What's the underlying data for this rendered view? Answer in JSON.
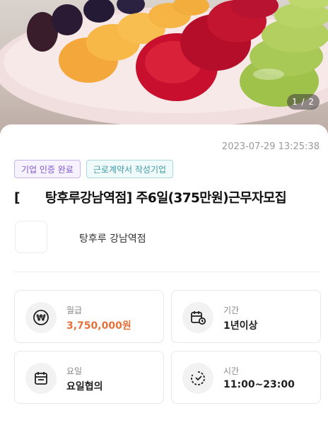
{
  "gallery": {
    "page_indicator": "1 / 2"
  },
  "post": {
    "timestamp": "2023-07-29 13:25:38",
    "badges": [
      "기업 인증 완료",
      "근로계약서 작성기업"
    ],
    "title_prefix": "[",
    "title_main": "탕후루강남역점] 주6일(375만원)근무자모집"
  },
  "company": {
    "name": "탕후루 강남역점"
  },
  "info_cards": [
    {
      "label": "월급",
      "value": "3,750,000원",
      "icon": "won-icon"
    },
    {
      "label": "기간",
      "value": "1년이상",
      "icon": "calendar-clock-icon"
    },
    {
      "label": "요일",
      "value": "요일협의",
      "icon": "calendar-icon"
    },
    {
      "label": "시간",
      "value": "11:00~23:00",
      "icon": "clock-icon"
    }
  ],
  "colors": {
    "accent": "#e5723a",
    "badge_purple": "#7e56c9",
    "badge_teal": "#3b9aa5"
  }
}
